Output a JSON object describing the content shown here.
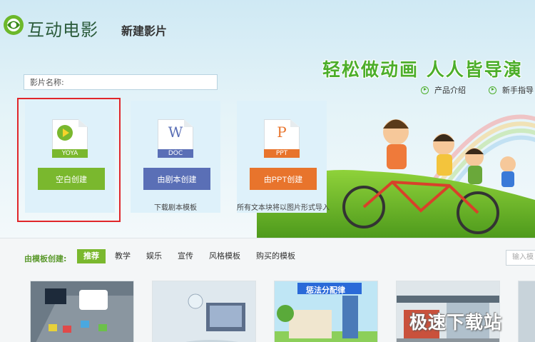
{
  "header": {
    "app_name": "互动电影",
    "page_title": "新建影片",
    "slogan": "轻松做动画   人人皆导演",
    "links": [
      {
        "label": "产品介绍"
      },
      {
        "label": "新手指导"
      }
    ]
  },
  "name_field": {
    "label": "影片名称:"
  },
  "cards": [
    {
      "file_label": "YOYA",
      "button_label": "空白创建",
      "caption": ""
    },
    {
      "file_label": "DOC",
      "letter": "W",
      "button_label": "由剧本创建",
      "caption": "下载剧本模板"
    },
    {
      "file_label": "PPT",
      "letter": "P",
      "button_label": "由PPT创建",
      "caption": "所有文本块将以图片形式导入"
    }
  ],
  "templates": {
    "label": "由模板创建:",
    "tabs": [
      "推荐",
      "教学",
      "娱乐",
      "宣传",
      "风格模板",
      "购买的模板"
    ],
    "active_tab": "推荐",
    "search_placeholder": "输入模",
    "thumb_texts": [
      "惩法分配律"
    ]
  },
  "watermark": "极速下载站",
  "colors": {
    "accent_green": "#7ab82e",
    "doc_blue": "#5a6fb6",
    "ppt_orange": "#e8742c",
    "select_red": "#e0262a"
  }
}
